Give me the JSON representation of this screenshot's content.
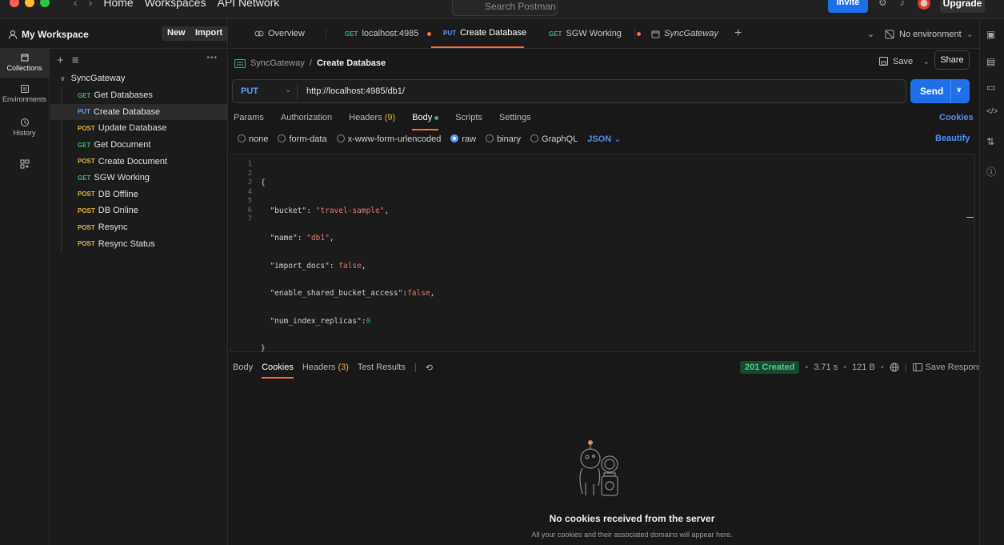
{
  "topbar": {
    "nav_home": "Home",
    "nav_workspaces": "Workspaces",
    "nav_api_network": "API Network",
    "search_placeholder": "Search Postman",
    "invite_label": "Invite",
    "upgrade_label": "Upgrade"
  },
  "workspace": {
    "title": "My Workspace",
    "new_label": "New",
    "import_label": "Import"
  },
  "tabs": [
    {
      "method": "",
      "label": "Overview"
    },
    {
      "method": "GET",
      "label": "localhost:4985"
    },
    {
      "method": "PUT",
      "label": "Create Database"
    },
    {
      "method": "GET",
      "label": "SGW Working"
    },
    {
      "method": "",
      "label": "SyncGateway"
    }
  ],
  "environment": {
    "label": "No environment"
  },
  "rail": [
    {
      "label": "Collections"
    },
    {
      "label": "Environments"
    },
    {
      "label": "History"
    }
  ],
  "tree": {
    "collection": "SyncGateway",
    "requests": [
      {
        "method": "GET",
        "name": "Get Databases"
      },
      {
        "method": "PUT",
        "name": "Create Database"
      },
      {
        "method": "POST",
        "name": "Update Database"
      },
      {
        "method": "GET",
        "name": "Get Document"
      },
      {
        "method": "POST",
        "name": "Create Document"
      },
      {
        "method": "GET",
        "name": "SGW Working"
      },
      {
        "method": "POST",
        "name": "DB Offline"
      },
      {
        "method": "POST",
        "name": "DB Online"
      },
      {
        "method": "POST",
        "name": "Resync"
      },
      {
        "method": "POST",
        "name": "Resync Status"
      }
    ]
  },
  "request": {
    "breadcrumb_parent": "SyncGateway",
    "breadcrumb_sep": "/",
    "breadcrumb_current": "Create Database",
    "save_label": "Save",
    "share_label": "Share",
    "method": "PUT",
    "url": "http://localhost:4985/db1/",
    "send_label": "Send",
    "tabs": {
      "params": "Params",
      "authorization": "Authorization",
      "headers": "Headers",
      "headers_count": "(9)",
      "body": "Body",
      "scripts": "Scripts",
      "settings": "Settings"
    },
    "cookies_label": "Cookies",
    "body_types": {
      "none": "none",
      "form_data": "form-data",
      "urlencoded": "x-www-form-urlencoded",
      "raw": "raw",
      "binary": "binary",
      "graphql": "GraphQL",
      "json": "JSON"
    },
    "beautify_label": "Beautify",
    "code": {
      "line_numbers": [
        "1",
        "2",
        "3",
        "4",
        "5",
        "6",
        "7"
      ],
      "open": "{",
      "l2_key": "\"bucket\"",
      "l2_val": "\"travel-sample\"",
      "l3_key": "\"name\"",
      "l3_val": "\"db1\"",
      "l4_key": "\"import_docs\"",
      "l4_val": "false",
      "l5_key": "\"enable_shared_bucket_access\"",
      "l5_val": "false",
      "l6_key": "\"num_index_replicas\"",
      "l6_val": "0",
      "close": "}"
    }
  },
  "response": {
    "tabs": {
      "body": "Body",
      "cookies": "Cookies",
      "headers": "Headers",
      "headers_count": "(3)",
      "test_results": "Test Results"
    },
    "status": "201 Created",
    "time": "3.71 s",
    "size": "121 B",
    "save_response": "Save Response",
    "empty_title": "No cookies received from the server",
    "empty_sub": "All your cookies and their associated domains will appear here."
  },
  "colors": {
    "accent": "#ff6c37",
    "primary_blue": "#1f6feb",
    "get": "#3fae6f",
    "put": "#5b9cff",
    "post": "#e3b23c",
    "status_ok": "#56c786"
  }
}
